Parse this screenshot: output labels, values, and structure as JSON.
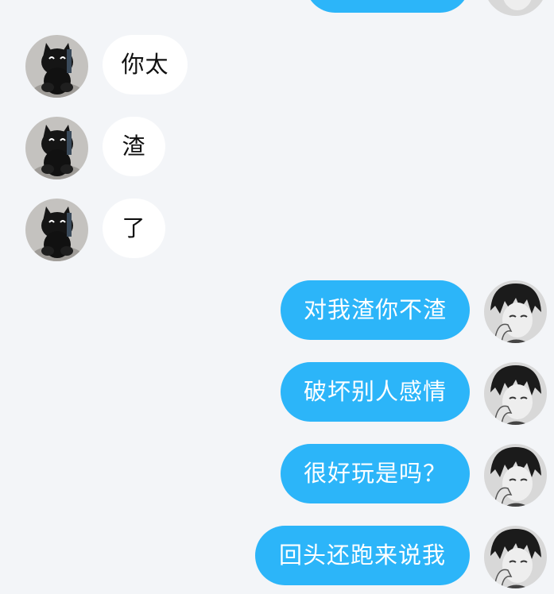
{
  "messages": [
    {
      "side": "in",
      "text": "你太"
    },
    {
      "side": "in",
      "text": "渣"
    },
    {
      "side": "in",
      "text": "了"
    },
    {
      "side": "out",
      "text": "对我渣你不渣"
    },
    {
      "side": "out",
      "text": "破坏别人感情"
    },
    {
      "side": "out",
      "text": "很好玩是吗？"
    },
    {
      "side": "out",
      "text": "回头还跑来说我"
    }
  ],
  "colors": {
    "background": "#f3f5f8",
    "incoming_bubble": "#ffffff",
    "outgoing_bubble": "#2cb5f9"
  },
  "icons": {
    "incoming_avatar": "cat-plush-avatar-icon",
    "outgoing_avatar": "anime-boy-avatar-icon"
  }
}
